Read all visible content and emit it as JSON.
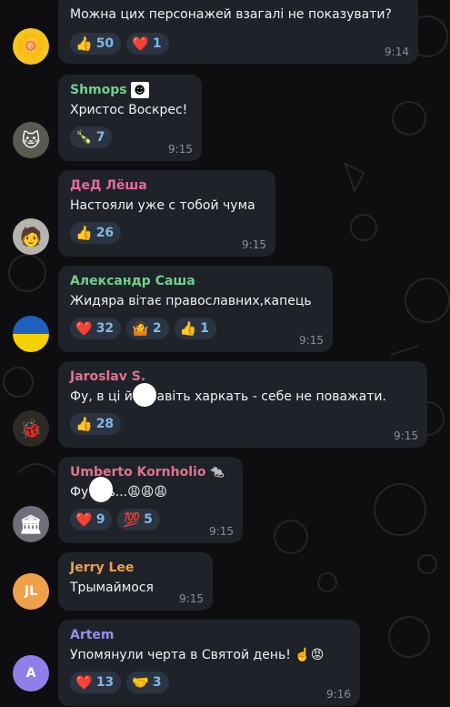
{
  "messages": [
    {
      "text": "Можна цих персонажей взагалі не показувати?",
      "reactions": [
        {
          "emoji": "👍",
          "count": "50"
        },
        {
          "emoji": "❤️",
          "count": "1"
        }
      ],
      "time": "9:14"
    },
    {
      "sender": "Shmops",
      "sender_color": "#6fd08c",
      "text": "Христос Воскрес!",
      "reactions": [
        {
          "emoji": "🍾",
          "count": "7"
        }
      ],
      "time": "9:15"
    },
    {
      "sender": "ДеД Лёша",
      "sender_color": "#e36aa5",
      "text": "Настояли уже с тобой чума",
      "reactions": [
        {
          "emoji": "👍",
          "count": "26"
        }
      ],
      "time": "9:15"
    },
    {
      "sender": "Александр Саша",
      "sender_color": "#6fd08c",
      "text": "Жидяра вітає православних,капець",
      "reactions": [
        {
          "emoji": "❤️",
          "count": "32"
        },
        {
          "emoji": "🤷",
          "count": "2"
        },
        {
          "emoji": "👍",
          "count": "1"
        }
      ],
      "time": "9:15"
    },
    {
      "sender": "Jaroslav S.",
      "sender_color": "#e3728c",
      "text": "Фу, в ці й      а навіть харкать - себе не поважати.",
      "reactions": [
        {
          "emoji": "👍",
          "count": "28"
        }
      ],
      "time": "9:15"
    },
    {
      "sender": "Umberto Kornholio",
      "sender_color": "#e3728c",
      "text": "Фу     ать...😩😩😩",
      "reactions": [
        {
          "emoji": "❤️",
          "count": "9"
        },
        {
          "emoji": "💯",
          "count": "5"
        }
      ],
      "time": "9:15"
    },
    {
      "sender": "Jerry Lee",
      "sender_color": "#f0a04b",
      "avatar_initials": "JL",
      "text": "Трымаймося",
      "time": "9:15"
    },
    {
      "sender": "Artem",
      "sender_color": "#9a8cf0",
      "avatar_initials": "A",
      "text": "Упомянули черта в Святой день! ☝️😡",
      "reactions": [
        {
          "emoji": "❤️",
          "count": "13"
        },
        {
          "emoji": "🤝",
          "count": "3"
        }
      ],
      "time": "9:16"
    }
  ],
  "colors": {
    "background": "#0e0e10",
    "bubble": "#1f2329",
    "reaction_bg": "#2b3440",
    "reaction_text": "#7fb8ec",
    "time": "#8a8f96"
  }
}
